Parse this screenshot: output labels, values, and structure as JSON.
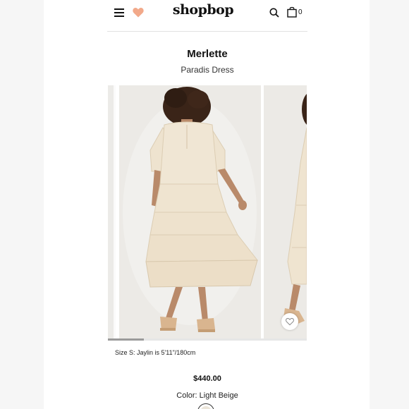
{
  "header": {
    "logo": "shopbop",
    "bag_count": "0",
    "icons": [
      "menu-icon",
      "heart-icon",
      "search-icon",
      "shopping-bag-icon"
    ],
    "heart_color": "#f2a98a"
  },
  "product": {
    "brand": "Merlette",
    "name": "Paradis Dress",
    "size_note": "Size S: Jaylin is 5'11\"/180cm",
    "price": "$440.00",
    "color_text": "Color: Light Beige",
    "swatch_color": "#ece6da"
  },
  "gallery": {
    "image_progress": 0.18,
    "favorite_icon": "heart-outline-icon"
  }
}
